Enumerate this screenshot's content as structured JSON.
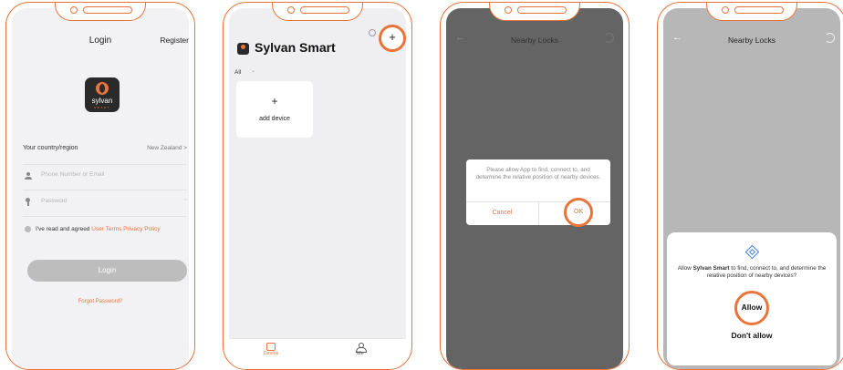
{
  "colors": {
    "accent": "#e8743b",
    "system_blue": "#3b7bde"
  },
  "login_screen": {
    "title": "Login",
    "register": "Register",
    "logo_text": "sylvan",
    "logo_sub": "SMART",
    "country_label": "Your country/region",
    "country_value": "New Zealand",
    "country_chevron": ">",
    "phone_placeholder": "Phone Number or Email",
    "password_placeholder": "Password",
    "password_toggle": "~",
    "agree_text": "I've read and agreed",
    "user_terms": "User Terms",
    "privacy_policy": "Privacy Policy",
    "login_button": "Login",
    "forgot_password": "Forgot Password?"
  },
  "device_screen": {
    "app_title": "Sylvan Smart",
    "filter_all": "All",
    "filter_chevron": "⌄",
    "add_plus": "+",
    "add_device": "add device",
    "header_plus": "+",
    "tab_device": "Device",
    "tab_me": "Me"
  },
  "app_permission_screen": {
    "back": "←",
    "title": "Nearby Locks",
    "dialog_text": "Please allow App to find, connect to, and determine the relative position of nearby devices.",
    "cancel": "Cancel",
    "ok": "OK"
  },
  "system_permission_screen": {
    "back": "←",
    "title": "Nearby Locks",
    "sheet_prefix": "Allow",
    "sheet_app": "Sylvan Smart",
    "sheet_suffix": "to find, connect to, and determine the relative position of nearby devices?",
    "allow": "Allow",
    "dont_allow": "Don't allow"
  }
}
